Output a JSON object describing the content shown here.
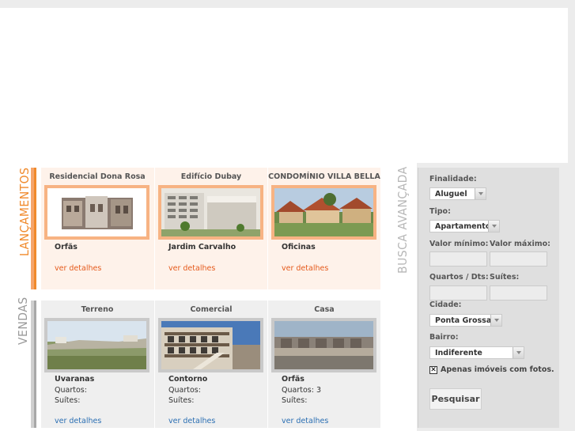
{
  "sections": {
    "launches_label": "LANÇAMENTOS",
    "sales_label": "VENDAS",
    "search_label": "BUSCA AVANÇADA"
  },
  "launches": [
    {
      "title": "Residencial Dona Rosa",
      "place": "Orfãs",
      "more": "ver detalhes"
    },
    {
      "title": "Edifício Dubay",
      "place": "Jardim Carvalho",
      "more": "ver detalhes"
    },
    {
      "title": "CONDOMÍNIO VILLA BELLA",
      "place": "Oficinas",
      "more": "ver detalhes"
    }
  ],
  "sales": [
    {
      "title": "Terreno",
      "place": "Uvaranas",
      "rooms_label": "Quartos:",
      "rooms": "",
      "suites_label": "Suítes:",
      "more": "ver detalhes"
    },
    {
      "title": "Comercial",
      "place": "Contorno",
      "rooms_label": "Quartos:",
      "rooms": "",
      "suites_label": "Suítes:",
      "more": "ver detalhes"
    },
    {
      "title": "Casa",
      "place": "Orfãs",
      "rooms_label": "Quartos:",
      "rooms": "3",
      "suites_label": "Suítes:",
      "more": "ver detalhes"
    }
  ],
  "search": {
    "finalidade_label": "Finalidade:",
    "finalidade_value": "Aluguel",
    "tipo_label": "Tipo:",
    "tipo_value": "Apartamento",
    "valor_min_label": "Valor mínimo:",
    "valor_max_label": "Valor máximo:",
    "quartos_label": "Quartos / Dts:",
    "suites_label": "Suítes:",
    "cidade_label": "Cidade:",
    "cidade_value": "Ponta Grossa",
    "bairro_label": "Bairro:",
    "bairro_value": "Indiferente",
    "fotos_label": "Apenas imóveis com fotos.",
    "fotos_checked": true,
    "submit_label": "Pesquisar"
  }
}
